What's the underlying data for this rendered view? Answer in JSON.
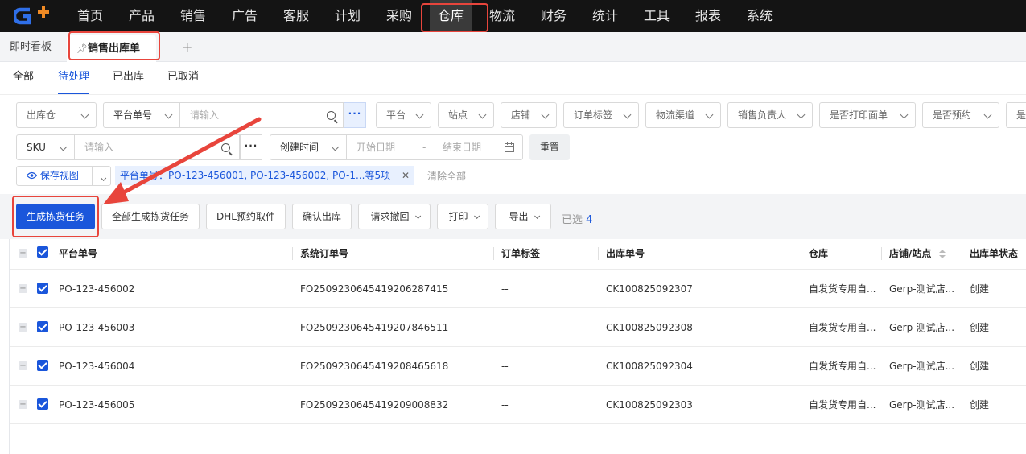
{
  "nav": {
    "items": [
      "首页",
      "产品",
      "销售",
      "广告",
      "客服",
      "计划",
      "采购",
      "仓库",
      "物流",
      "财务",
      "统计",
      "工具",
      "报表",
      "系统"
    ],
    "active": "仓库"
  },
  "tabs": {
    "items": [
      "即时看板",
      "销售出库单"
    ],
    "active": "销售出库单",
    "add": "+"
  },
  "status_tabs": {
    "items": [
      "全部",
      "待处理",
      "已出库",
      "已取消"
    ],
    "active": "待处理"
  },
  "filters": {
    "warehouse": "出库仓",
    "platform_no_select": "平台单号",
    "platform_no_placeholder": "请输入",
    "platform": "平台",
    "site": "站点",
    "store": "店铺",
    "order_tag": "订单标签",
    "logistics": "物流渠道",
    "sales_owner": "销售负责人",
    "printed_label": "是否打印面单",
    "reserved": "是否预约",
    "more_cut": "是",
    "sku_select": "SKU",
    "sku_placeholder": "请输入",
    "date_type": "创建时间",
    "start_date": "开始日期",
    "date_sep": "-",
    "end_date": "结束日期",
    "reset": "重置",
    "save_view": "保存视图",
    "chip": "平台单号：PO-123-456001, PO-123-456002, PO-1...等5项",
    "clear_all": "清除全部",
    "more_dots": "···"
  },
  "actions": {
    "generate_pick": "生成拣货任务",
    "generate_all_pick": "全部生成拣货任务",
    "dhl_pickup": "DHL预约取件",
    "confirm_out": "确认出库",
    "request_revoke": "请求撤回",
    "print": "打印",
    "export": "导出",
    "selected_label": "已选",
    "selected_count": "4"
  },
  "table": {
    "headers": [
      "平台单号",
      "系统订单号",
      "订单标签",
      "出库单号",
      "仓库",
      "店铺/站点",
      "出库单状态"
    ],
    "rows": [
      [
        "PO-123-456002",
        "FO2509230645419206287415",
        "--",
        "CK100825092307",
        "自发货专用自...",
        "Gerp-测试店...",
        "创建"
      ],
      [
        "PO-123-456003",
        "FO2509230645419207846511",
        "--",
        "CK100825092308",
        "自发货专用自...",
        "Gerp-测试店...",
        "创建"
      ],
      [
        "PO-123-456004",
        "FO2509230645419208465618",
        "--",
        "CK100825092304",
        "自发货专用自...",
        "Gerp-测试店...",
        "创建"
      ],
      [
        "PO-123-456005",
        "FO2509230645419209008832",
        "--",
        "CK100825092303",
        "自发货专用自...",
        "Gerp-测试店...",
        "创建"
      ]
    ]
  },
  "colors": {
    "accent": "#1a56db",
    "highlight": "#e8453c",
    "topbar": "#141414"
  }
}
